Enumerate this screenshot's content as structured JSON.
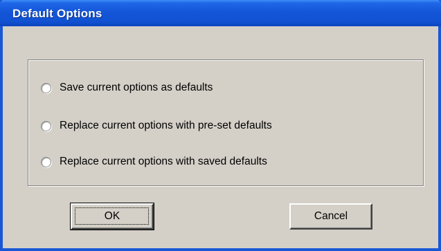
{
  "dialog": {
    "title": "Default Options",
    "options": [
      {
        "label": "Save current options as defaults",
        "selected": false
      },
      {
        "label": "Replace current options with pre-set defaults",
        "selected": false
      },
      {
        "label": "Replace current options with saved defaults",
        "selected": false
      }
    ],
    "ok_label": "OK",
    "cancel_label": "Cancel"
  },
  "colors": {
    "titlebar": "#1456d8",
    "face": "#d4d0c8",
    "title_text": "#ffffff"
  }
}
